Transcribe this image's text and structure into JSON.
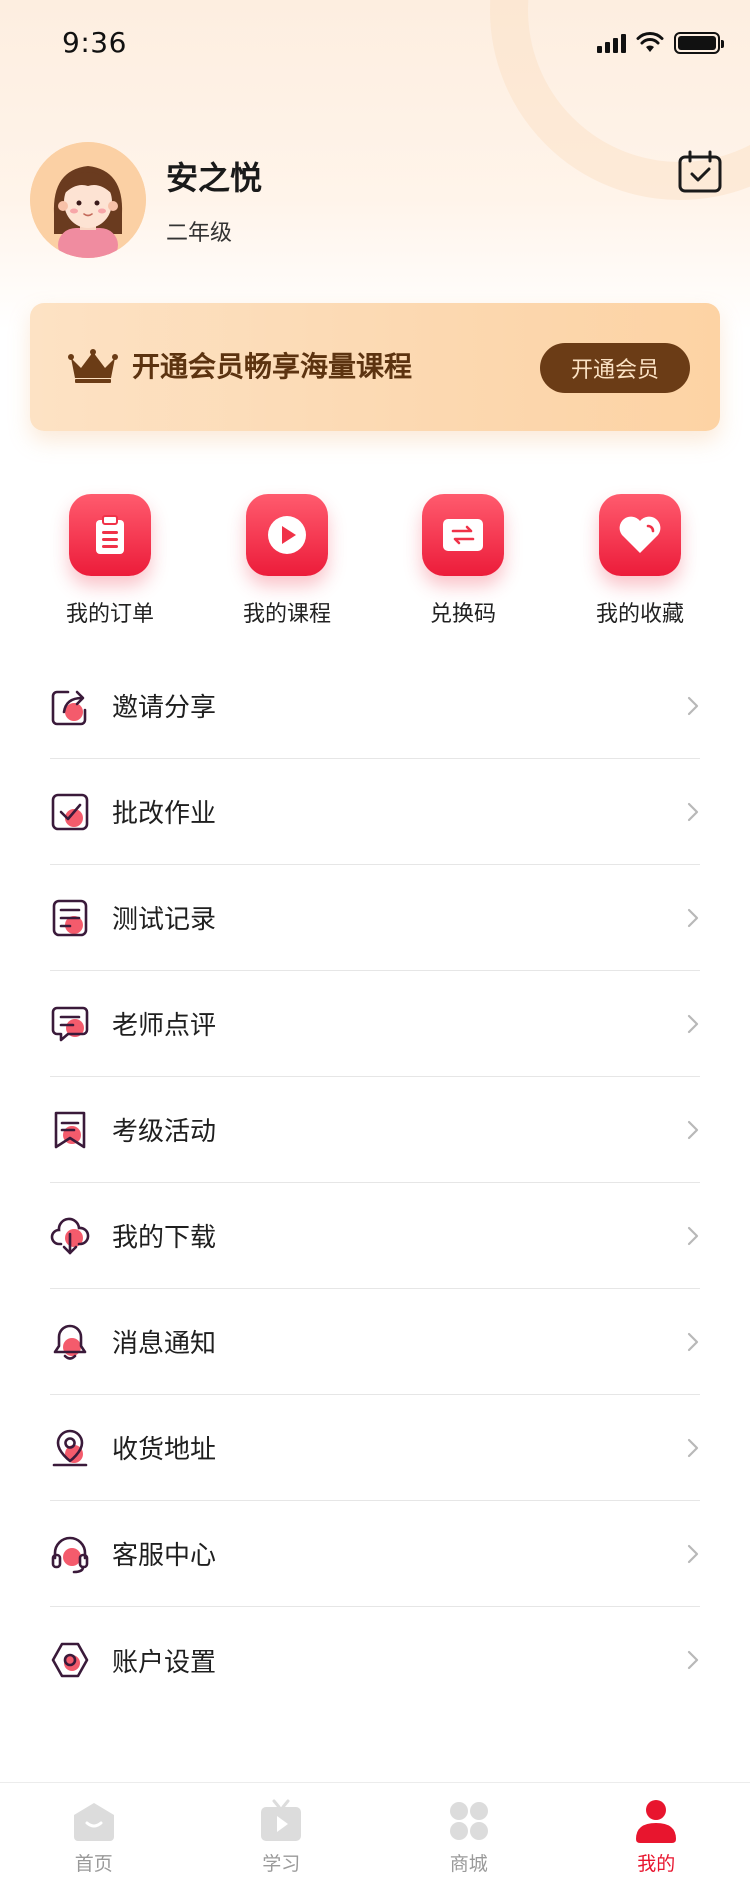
{
  "status_bar": {
    "time": "9:36"
  },
  "profile": {
    "name": "安之悦",
    "grade": "二年级"
  },
  "vip_banner": {
    "text": "开通会员畅享海量课程",
    "button": "开通会员"
  },
  "quick_actions": [
    {
      "label": "我的订单",
      "icon": "clipboard-icon"
    },
    {
      "label": "我的课程",
      "icon": "play-icon"
    },
    {
      "label": "兑换码",
      "icon": "exchange-icon"
    },
    {
      "label": "我的收藏",
      "icon": "heart-icon"
    }
  ],
  "menu": [
    {
      "label": "邀请分享",
      "icon": "share-icon"
    },
    {
      "label": "批改作业",
      "icon": "check-box-icon"
    },
    {
      "label": "测试记录",
      "icon": "record-icon"
    },
    {
      "label": "老师点评",
      "icon": "comment-icon"
    },
    {
      "label": "考级活动",
      "icon": "bookmark-icon"
    },
    {
      "label": "我的下载",
      "icon": "cloud-download-icon"
    },
    {
      "label": "消息通知",
      "icon": "bell-icon"
    },
    {
      "label": "收货地址",
      "icon": "location-icon"
    },
    {
      "label": "客服中心",
      "icon": "headset-icon"
    },
    {
      "label": "账户设置",
      "icon": "settings-icon"
    }
  ],
  "tab_bar": [
    {
      "label": "首页",
      "icon": "home-icon",
      "active": false
    },
    {
      "label": "学习",
      "icon": "tv-icon",
      "active": false
    },
    {
      "label": "商城",
      "icon": "grid-icon",
      "active": false
    },
    {
      "label": "我的",
      "icon": "user-icon",
      "active": true
    }
  ],
  "colors": {
    "accent": "#e8152e",
    "brown": "#6b3c16",
    "icon_dark": "#3a1a3a",
    "icon_pink": "#f45b6c"
  }
}
